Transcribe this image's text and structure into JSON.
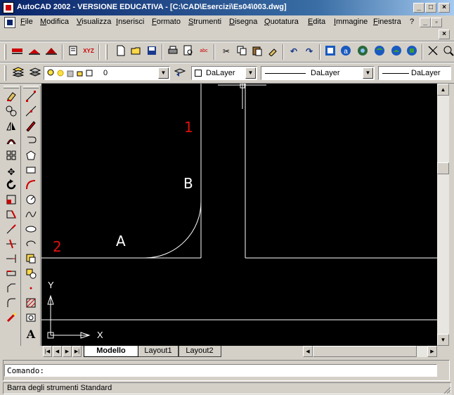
{
  "window": {
    "title": "AutoCAD 2002 - VERSIONE EDUCATIVA - [C:\\CAD\\Esercizi\\Es04\\003.dwg]"
  },
  "menu": [
    {
      "label": "File"
    },
    {
      "label": "Modifica"
    },
    {
      "label": "Visualizza"
    },
    {
      "label": "Inserisci"
    },
    {
      "label": "Formato"
    },
    {
      "label": "Strumenti"
    },
    {
      "label": "Disegna"
    },
    {
      "label": "Quotatura"
    },
    {
      "label": "Edita"
    },
    {
      "label": "Immagine"
    },
    {
      "label": "Finestra"
    },
    {
      "label": "?"
    }
  ],
  "properties": {
    "layer_value": "0",
    "color_value": "DaLayer",
    "linetype_value": "DaLayer",
    "lineweight_value": "DaLayer"
  },
  "drawing": {
    "label_1": "1",
    "label_2": "2",
    "label_a": "A",
    "label_b": "B",
    "ucs_x": "X",
    "ucs_y": "Y"
  },
  "tabs": [
    {
      "label": "Modello",
      "active": true
    },
    {
      "label": "Layout1",
      "active": false
    },
    {
      "label": "Layout2",
      "active": false
    }
  ],
  "command": {
    "prompt": "Comando:"
  },
  "status": {
    "text": "Barra degli strumenti Standard"
  },
  "icons": {
    "standard_toolbar": [
      "new-icon",
      "open-icon",
      "save-icon",
      "print-icon",
      "print-preview-icon",
      "spell-check-icon",
      "cut-icon",
      "copy-icon",
      "paste-icon",
      "match-properties-icon",
      "undo-icon",
      "redo-icon",
      "hyperlink-icon",
      "today-icon",
      "meet-now-icon",
      "internet-icon",
      "publish-icon",
      "cursor-icon"
    ],
    "modify_toolbar": [
      "erase-icon",
      "copy-object-icon",
      "mirror-icon",
      "offset-icon",
      "array-icon",
      "move-icon",
      "rotate-icon",
      "scale-icon",
      "stretch-icon",
      "lengthen-icon",
      "trim-icon",
      "extend-icon",
      "break-icon",
      "chamfer-icon",
      "fillet-icon",
      "explode-icon"
    ],
    "draw_toolbar": [
      "line-icon",
      "construction-line-icon",
      "polyline-icon",
      "polygon-icon",
      "rectangle-icon",
      "arc-icon",
      "circle-icon",
      "spline-icon",
      "ellipse-icon",
      "revision-cloud-icon",
      "block-insert-icon",
      "make-block-icon",
      "point-icon",
      "hatch-icon",
      "region-icon",
      "multiline-text-icon"
    ]
  },
  "colors": {
    "canvas": "#000000",
    "line": "#ffffff",
    "label_red": "#e01010",
    "titlebar": "#0a246a"
  }
}
